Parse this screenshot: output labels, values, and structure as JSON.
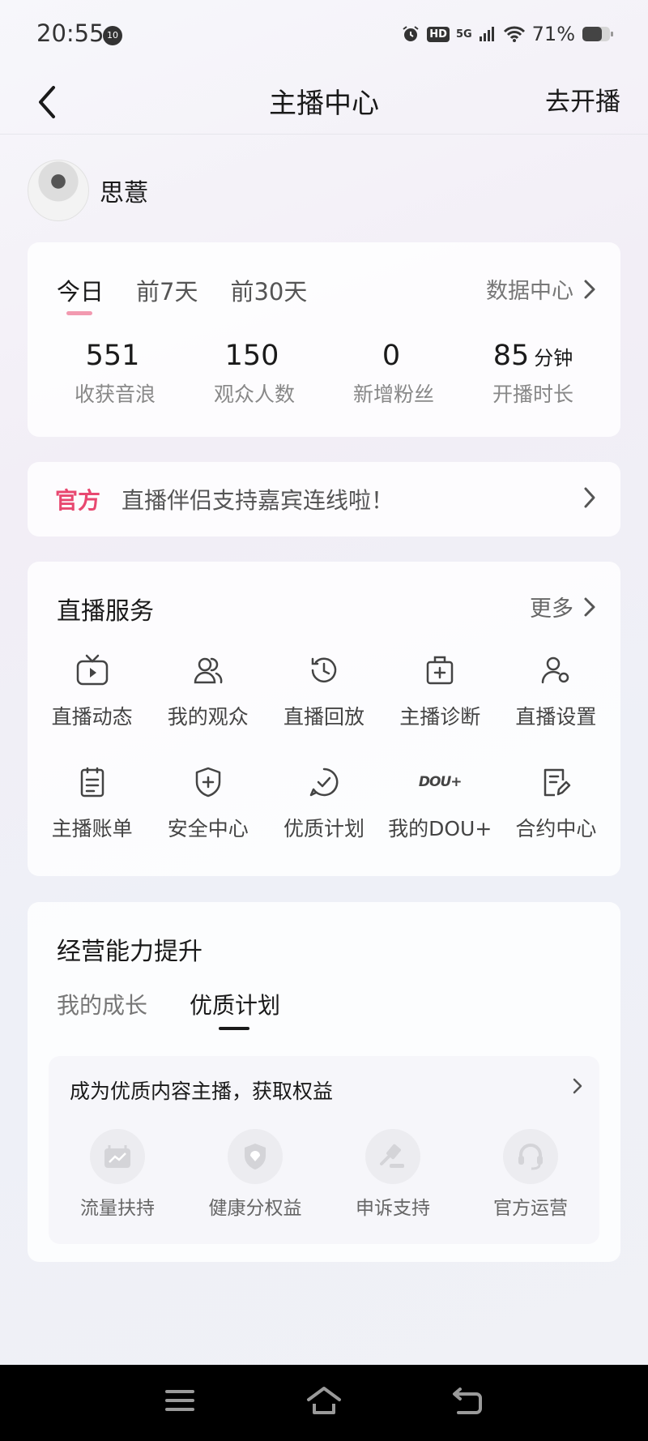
{
  "status_bar": {
    "time": "20:55",
    "notification_badge": "10",
    "network": "5G",
    "hd": "HD",
    "battery_percent": "71%",
    "battery_level": 0.71
  },
  "header": {
    "title": "主播中心",
    "action_label": "去开播"
  },
  "profile": {
    "name": "思薏"
  },
  "stats": {
    "tabs": [
      "今日",
      "前7天",
      "前30天"
    ],
    "active_tab": "今日",
    "data_center_label": "数据中心",
    "items": [
      {
        "value": "551",
        "unit": "",
        "label": "收获音浪"
      },
      {
        "value": "150",
        "unit": "",
        "label": "观众人数"
      },
      {
        "value": "0",
        "unit": "",
        "label": "新增粉丝"
      },
      {
        "value": "85",
        "unit": "分钟",
        "label": "开播时长"
      }
    ]
  },
  "notice": {
    "tag": "官方",
    "text": "直播伴侣支持嘉宾连线啦！"
  },
  "live_services": {
    "title": "直播服务",
    "more_label": "更多",
    "items": [
      {
        "label": "直播动态",
        "icon": "tv-play-icon"
      },
      {
        "label": "我的观众",
        "icon": "audience-icon"
      },
      {
        "label": "直播回放",
        "icon": "history-icon"
      },
      {
        "label": "主播诊断",
        "icon": "medical-kit-icon"
      },
      {
        "label": "直播设置",
        "icon": "user-settings-icon"
      },
      {
        "label": "主播账单",
        "icon": "bill-icon"
      },
      {
        "label": "安全中心",
        "icon": "shield-plus-icon"
      },
      {
        "label": "优质计划",
        "icon": "check-circle-icon"
      },
      {
        "label": "我的DOU+",
        "icon": "dou-plus-icon"
      },
      {
        "label": "合约中心",
        "icon": "contract-edit-icon"
      }
    ]
  },
  "growth": {
    "title": "经营能力提升",
    "tabs": [
      "我的成长",
      "优质计划"
    ],
    "active_tab": "优质计划",
    "banner": "成为优质内容主播，获取权益",
    "benefits": [
      {
        "label": "流量扶持",
        "icon": "traffic-chart-icon"
      },
      {
        "label": "健康分权益",
        "icon": "shield-icon"
      },
      {
        "label": "申诉支持",
        "icon": "gavel-icon"
      },
      {
        "label": "官方运营",
        "icon": "headset-icon"
      }
    ]
  },
  "colors": {
    "accent_pink": "#e84870",
    "tab_underline": "#f29ab0"
  }
}
